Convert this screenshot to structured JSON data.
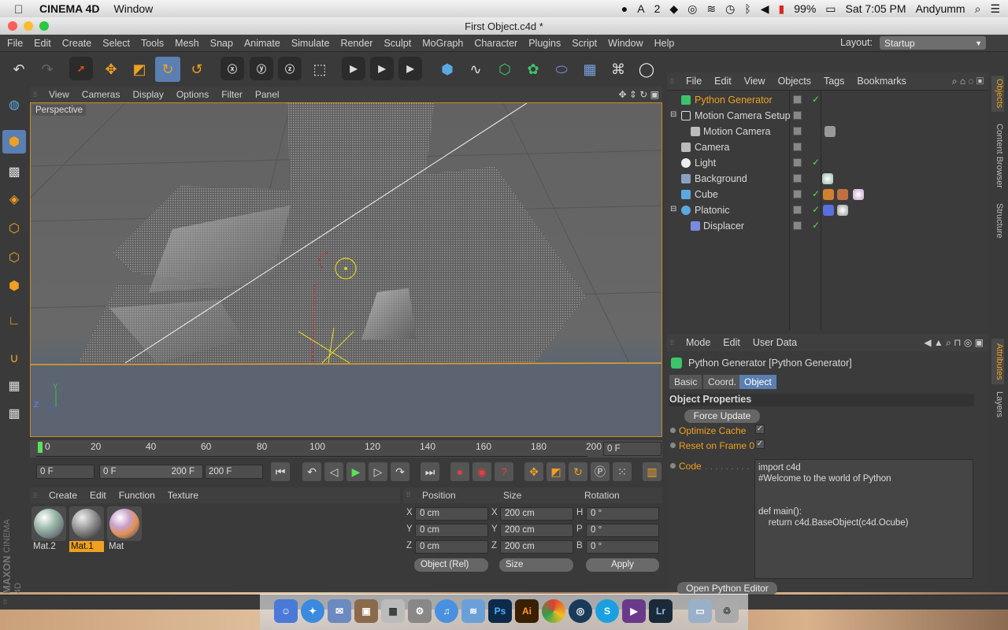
{
  "menubar": {
    "app_name": "CINEMA 4D",
    "menu": "Window",
    "status_badge": "2",
    "battery": "99%",
    "clock": "Sat 7:05 PM",
    "user": "Andyumm"
  },
  "window": {
    "title": "First Object.c4d *"
  },
  "app_menu": [
    "File",
    "Edit",
    "Create",
    "Select",
    "Tools",
    "Mesh",
    "Snap",
    "Animate",
    "Simulate",
    "Render",
    "Sculpt",
    "MoGraph",
    "Character",
    "Plugins",
    "Script",
    "Window",
    "Help"
  ],
  "layout": {
    "label": "Layout:",
    "value": "Startup"
  },
  "viewport": {
    "menu": [
      "View",
      "Cameras",
      "Display",
      "Options",
      "Filter",
      "Panel"
    ],
    "label": "Perspective",
    "axis_y": "Y",
    "axis_z": "Z"
  },
  "timeline": {
    "ticks": [
      "0",
      "20",
      "40",
      "60",
      "80",
      "100",
      "120",
      "140",
      "160",
      "180",
      "200"
    ],
    "current_frame": "0 F"
  },
  "transport": {
    "start": "0 F",
    "range_start": "0 F",
    "range_end": "200 F",
    "end": "200 F"
  },
  "materials": {
    "menu": [
      "Create",
      "Edit",
      "Function",
      "Texture"
    ],
    "items": [
      {
        "name": "Mat.2",
        "selected": false,
        "color": "#9ab8a8"
      },
      {
        "name": "Mat.1",
        "selected": true,
        "color": "#9a9a9a"
      },
      {
        "name": "Mat",
        "selected": false,
        "color": "#c8a0c8"
      }
    ]
  },
  "coords": {
    "headers": {
      "position": "Position",
      "size": "Size",
      "rotation": "Rotation"
    },
    "rows": [
      {
        "axis": "X",
        "pos": "0 cm",
        "size_axis": "X",
        "size": "200 cm",
        "rot_axis": "H",
        "rot": "0 °"
      },
      {
        "axis": "Y",
        "pos": "0 cm",
        "size_axis": "Y",
        "size": "200 cm",
        "rot_axis": "P",
        "rot": "0 °"
      },
      {
        "axis": "Z",
        "pos": "0 cm",
        "size_axis": "Z",
        "size": "200 cm",
        "rot_axis": "B",
        "rot": "0 °"
      }
    ],
    "mode": "Object (Rel)",
    "size_mode": "Size",
    "apply": "Apply"
  },
  "brand": {
    "maxon": "MAXON",
    "cinema": "CINEMA 4D"
  },
  "objects": {
    "menu": [
      "File",
      "Edit",
      "View",
      "Objects",
      "Tags",
      "Bookmarks"
    ],
    "items": [
      {
        "name": "Python Generator",
        "selected": true,
        "color": "#f0a020"
      },
      {
        "name": "Motion Camera Setup",
        "selected": false
      },
      {
        "name": "Motion Camera",
        "selected": false
      },
      {
        "name": "Camera",
        "selected": false
      },
      {
        "name": "Light",
        "selected": false
      },
      {
        "name": "Background",
        "selected": false
      },
      {
        "name": "Cube",
        "selected": false
      },
      {
        "name": "Platonic",
        "selected": false
      },
      {
        "name": "Displacer",
        "selected": false
      }
    ]
  },
  "sidetabs": [
    "Objects",
    "Content Browser",
    "Structure",
    "Attributes",
    "Layers"
  ],
  "attributes": {
    "menu": [
      "Mode",
      "Edit",
      "User Data"
    ],
    "title": "Python Generator [Python Generator]",
    "tabs": [
      "Basic",
      "Coord.",
      "Object"
    ],
    "selected_tab": "Object",
    "section": "Object Properties",
    "force_update": "Force Update",
    "optimize_cache": "Optimize Cache",
    "reset_frame": "Reset on Frame 0",
    "code_label": "Code",
    "code": "import c4d\n#Welcome to the world of Python\n\n\ndef main():\n    return c4d.BaseObject(c4d.Ocube)",
    "open_editor": "Open Python Editor"
  },
  "dock": [
    "Ps",
    "Ai",
    "Lr"
  ]
}
